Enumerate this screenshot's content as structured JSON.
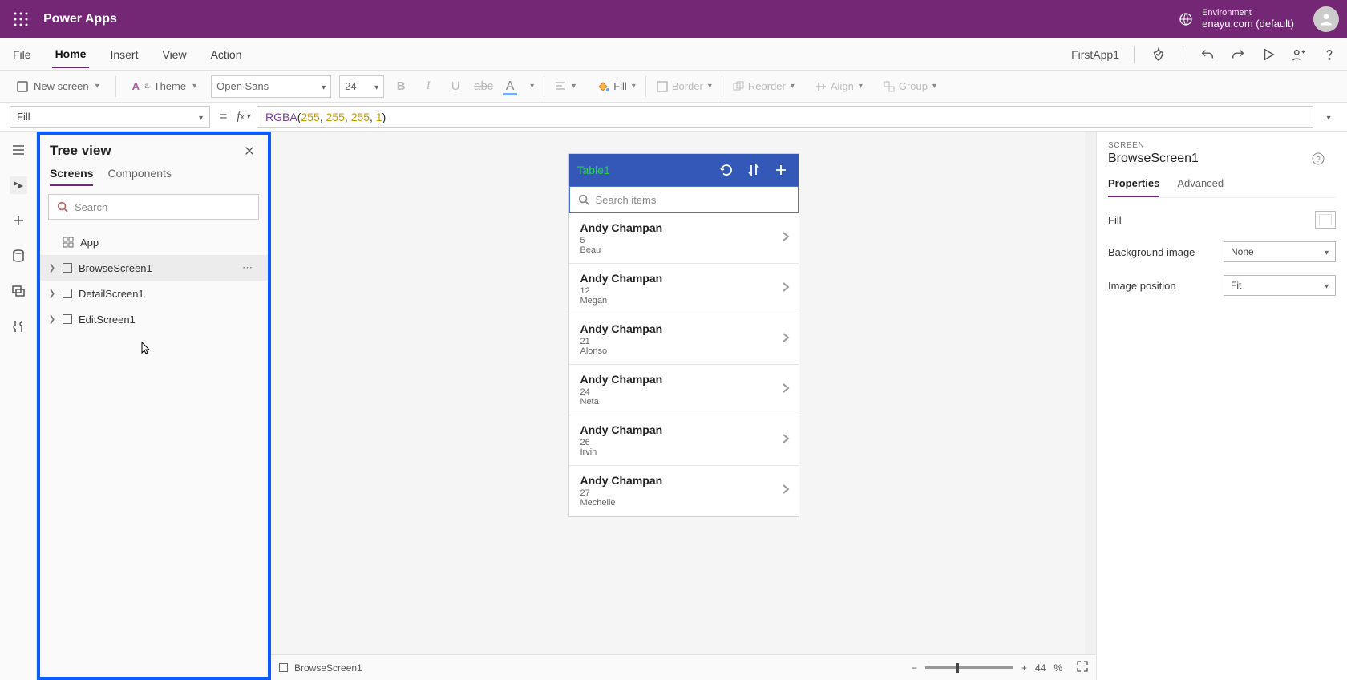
{
  "topbar": {
    "app": "Power Apps",
    "env_label": "Environment",
    "env_value": "enayu.com (default)"
  },
  "menu": {
    "items": [
      "File",
      "Home",
      "Insert",
      "View",
      "Action"
    ],
    "active_index": 1,
    "app_name": "FirstApp1"
  },
  "ribbon": {
    "new_screen": "New screen",
    "theme": "Theme",
    "font": "Open Sans",
    "size": "24",
    "fill": "Fill",
    "border": "Border",
    "reorder": "Reorder",
    "align": "Align",
    "group": "Group"
  },
  "formula": {
    "property": "Fill",
    "fn": "RGBA",
    "a1": "255",
    "a2": "255",
    "a3": "255",
    "a4": "1"
  },
  "tree": {
    "title": "Tree view",
    "tabs": {
      "screens": "Screens",
      "components": "Components"
    },
    "search_placeholder": "Search",
    "app_label": "App",
    "items": [
      {
        "label": "BrowseScreen1",
        "selected": true
      },
      {
        "label": "DetailScreen1",
        "selected": false
      },
      {
        "label": "EditScreen1",
        "selected": false
      }
    ]
  },
  "phone": {
    "title": "Table1",
    "search_placeholder": "Search items",
    "rows": [
      {
        "name": "Andy Champan",
        "line2": "5",
        "line3": "Beau"
      },
      {
        "name": "Andy Champan",
        "line2": "12",
        "line3": "Megan"
      },
      {
        "name": "Andy Champan",
        "line2": "21",
        "line3": "Alonso"
      },
      {
        "name": "Andy Champan",
        "line2": "24",
        "line3": "Neta"
      },
      {
        "name": "Andy Champan",
        "line2": "26",
        "line3": "Irvin"
      },
      {
        "name": "Andy Champan",
        "line2": "27",
        "line3": "Mechelle"
      }
    ]
  },
  "footer": {
    "screen": "BrowseScreen1",
    "zoom": "44",
    "pct": "%"
  },
  "props": {
    "section": "SCREEN",
    "name": "BrowseScreen1",
    "tabs": {
      "properties": "Properties",
      "advanced": "Advanced"
    },
    "fill_label": "Fill",
    "bg_label": "Background image",
    "bg_value": "None",
    "imgpos_label": "Image position",
    "imgpos_value": "Fit"
  }
}
